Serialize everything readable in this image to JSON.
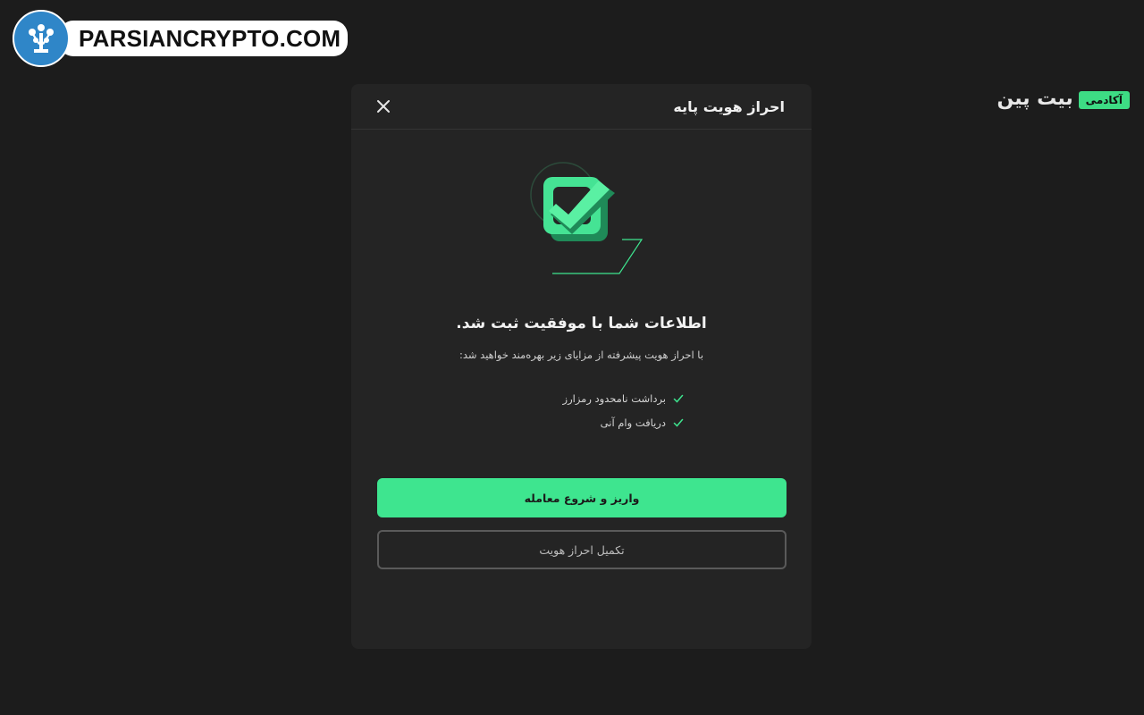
{
  "watermark": {
    "text": "PARSIANCRYPTO.COM",
    "logo_icon": "tree-logo-icon"
  },
  "brand": {
    "name": "بیت پین",
    "badge": "آکادمی",
    "accent_color": "#3ddc84"
  },
  "modal": {
    "title": "احراز هویت پایه",
    "close_icon": "close-icon",
    "illustration_icon": "checkbox-check-icon",
    "success_title": "اطلاعات شما با موفقیت ثبت شد.",
    "subtitle": "با احراز هویت پیشرفته از مزایای زیر بهره‌مند خواهید شد:",
    "benefits": [
      {
        "label": "برداشت نامحدود رمزارز",
        "icon": "check-icon"
      },
      {
        "label": "دریافت وام آنی",
        "icon": "check-icon"
      }
    ],
    "primary_button": "واریز و شروع معامله",
    "secondary_button": "تکمیل احراز هویت"
  },
  "colors": {
    "background": "#1c1c1c",
    "modal": "#242424",
    "primary": "#3ee58f"
  }
}
